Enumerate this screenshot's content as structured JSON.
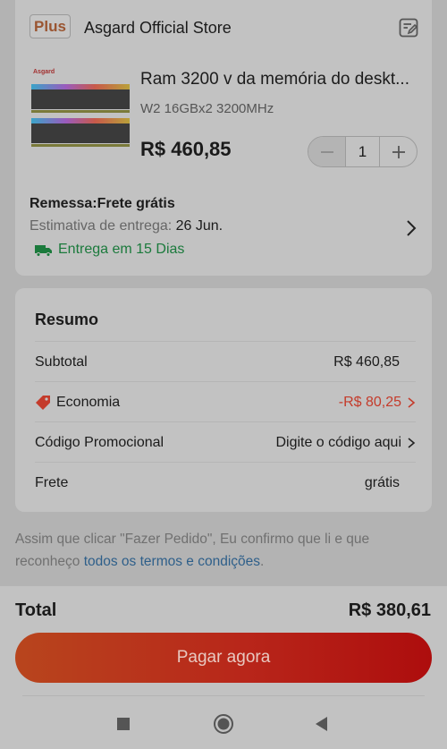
{
  "store": {
    "badge": "Plus",
    "name": "Asgard Official Store"
  },
  "product": {
    "image_brand": "Asgard",
    "title": "Ram 3200 v da memória do deskt...",
    "variant": "W2 16GBx2 3200MHz",
    "price": "R$ 460,85",
    "quantity": "1"
  },
  "shipping": {
    "title": "Remessa:Frete grátis",
    "estimate_label": "Estimativa de entrega: ",
    "estimate_date": "26 Jun.",
    "eta": "Entrega em 15 Dias"
  },
  "summary": {
    "title": "Resumo",
    "rows": [
      {
        "label": "Subtotal",
        "value": "R$ 460,85"
      },
      {
        "label": "Economia",
        "value": "-R$ 80,25"
      },
      {
        "label": "Código Promocional",
        "value": "Digite o código aqui"
      },
      {
        "label": "Frete",
        "value": "grátis"
      }
    ]
  },
  "terms": {
    "text": "Assim que clicar \"Fazer Pedido\", Eu confirmo que li e que reconheço ",
    "link": "todos os termos e condições",
    "end": "."
  },
  "footer": {
    "total_label": "Total",
    "total_value": "R$ 380,61",
    "pay_button": "Pagar agora"
  },
  "colors": {
    "accent_red": "#c43b2b",
    "delivery_green": "#1b7a3c",
    "link_blue": "#2e5f8a",
    "pay_button": "#b8261a"
  },
  "icons": [
    "edit-note-icon",
    "minus-icon",
    "plus-icon",
    "chevron-right-icon",
    "truck-icon",
    "price-tag-icon",
    "nav-recents-icon",
    "nav-home-icon",
    "nav-back-icon"
  ]
}
